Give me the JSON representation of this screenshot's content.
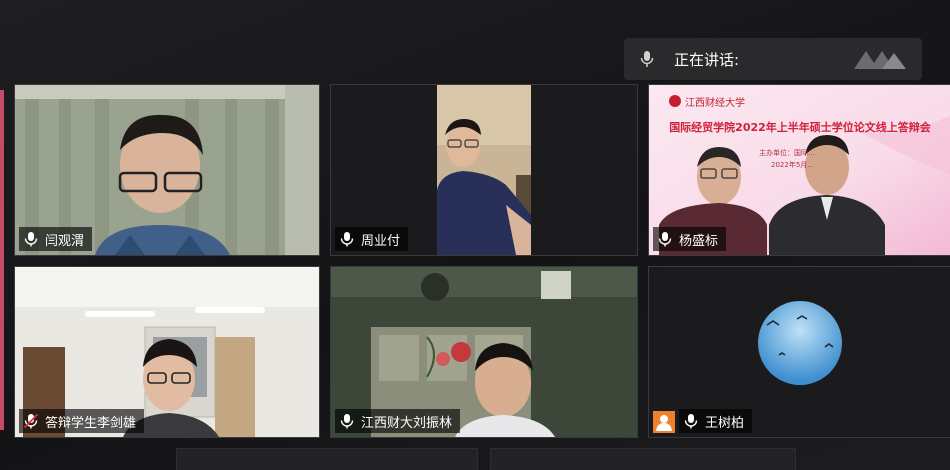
{
  "speaking": {
    "label": "正在讲话:"
  },
  "participants": [
    {
      "name": "闫观渭",
      "muted": false
    },
    {
      "name": "周业付",
      "muted": false
    },
    {
      "name": "杨盛标",
      "muted": false
    },
    {
      "name": "答辩学生李剑雄",
      "muted": true
    },
    {
      "name": "江西财大刘振林",
      "muted": false
    },
    {
      "name": "王树柏",
      "muted": false
    }
  ],
  "banner": {
    "university": "江西财经大学",
    "title": "国际经贸学院2022年上半年硕士学位论文线上答辩会",
    "organizer": "主办单位：国际...",
    "date": "2022年5月..."
  },
  "colors": {
    "accent": "#c64a6a",
    "avatar_badge": "#f0802a",
    "banner_title": "#d0203a"
  }
}
